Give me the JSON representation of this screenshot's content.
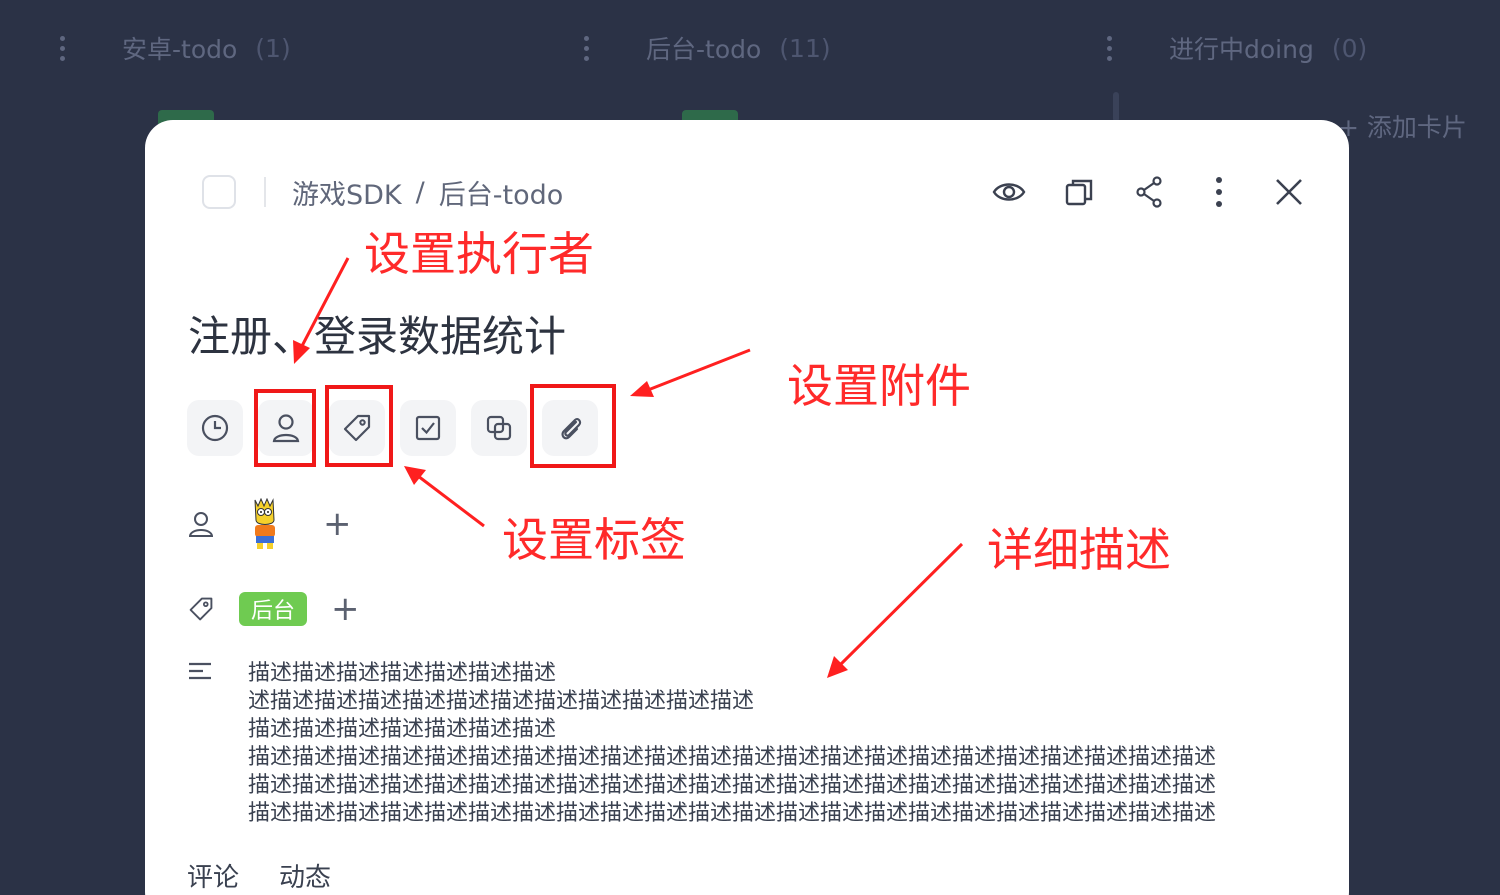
{
  "board": {
    "columns": [
      {
        "title": "安卓-todo",
        "count": "(1)"
      },
      {
        "title": "后台-todo",
        "count": "(11)"
      },
      {
        "title": "进行中doing",
        "count": "(0)"
      }
    ],
    "add_card": "+ 添加卡片"
  },
  "modal": {
    "breadcrumb": {
      "project": "游戏SDK",
      "separator": "/",
      "list": "后台-todo"
    },
    "actions": [
      "eye-icon",
      "copy-icon",
      "share-icon",
      "more-icon",
      "close-icon"
    ],
    "title": "注册、登录数据统计",
    "tools": [
      "clock-icon",
      "user-icon",
      "tag-icon",
      "checklist-icon",
      "duplicate-icon",
      "attachment-icon"
    ],
    "tag_label": "后台",
    "description_lines": [
      "描述描述描述描述描述描述描述",
      "述描述描述描述描述描述描述描述描述描述描述描述",
      "描述描述描述描述描述描述描述",
      "描述描述描述描述描述描述描述描述描述描述描述描述描述描述描述描述描述描述描述描述描述描述",
      "描述描述描述描述描述描述描述描述描述描述描述描述描述描述描述描述描述描述描述描述描述描述",
      "描述描述描述描述描述描述描述描述描述描述描述描述描述描述描述描述描述描述描述描述描述描述"
    ],
    "tabs": [
      "评论",
      "动态"
    ]
  },
  "annotations": {
    "assignee": "设置执行者",
    "attachment": "设置附件",
    "tag": "设置标签",
    "description": "详细描述",
    "color": "#ff2a2a"
  }
}
